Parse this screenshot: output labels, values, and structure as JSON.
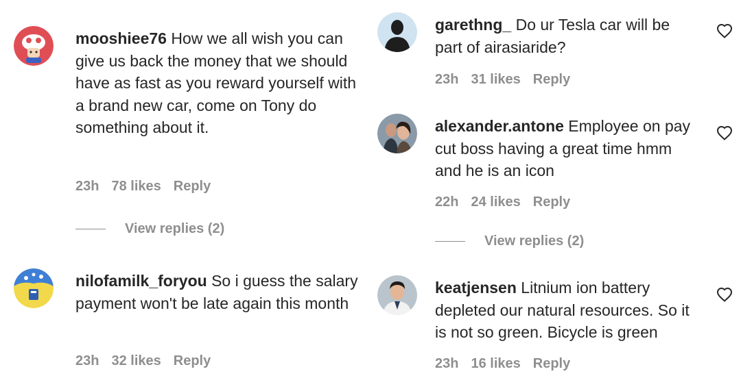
{
  "comments": [
    {
      "username": "mooshiee76",
      "text": " How we all wish you can give us back the money that we should have as fast as you reward yourself with a brand new car, come on Tony do something about it.",
      "time": "23h",
      "likes": "78 likes",
      "reply": "Reply",
      "view_replies": "View replies (2)"
    },
    {
      "username": "nilofamilk_foryou",
      "text": " So i guess the salary payment won't be late again this month",
      "time": "23h",
      "likes": "32 likes",
      "reply": "Reply"
    },
    {
      "username": "garethng_",
      "text": " Do ur Tesla car will be part of airasiaride?",
      "time": "23h",
      "likes": "31 likes",
      "reply": "Reply"
    },
    {
      "username": "alexander.antone",
      "text": " Employee on pay cut boss having a great time hmm and he is an icon",
      "time": "22h",
      "likes": "24 likes",
      "reply": "Reply",
      "view_replies": "View replies (2)"
    },
    {
      "username": "keatjensen",
      "text": " Litnium ion battery depleted our natural resources. So it is not so green. Bicycle is green",
      "time": "23h",
      "likes": "16 likes",
      "reply": "Reply"
    }
  ],
  "colors": {
    "text": "#262626",
    "secondary": "#8e8e8e"
  }
}
